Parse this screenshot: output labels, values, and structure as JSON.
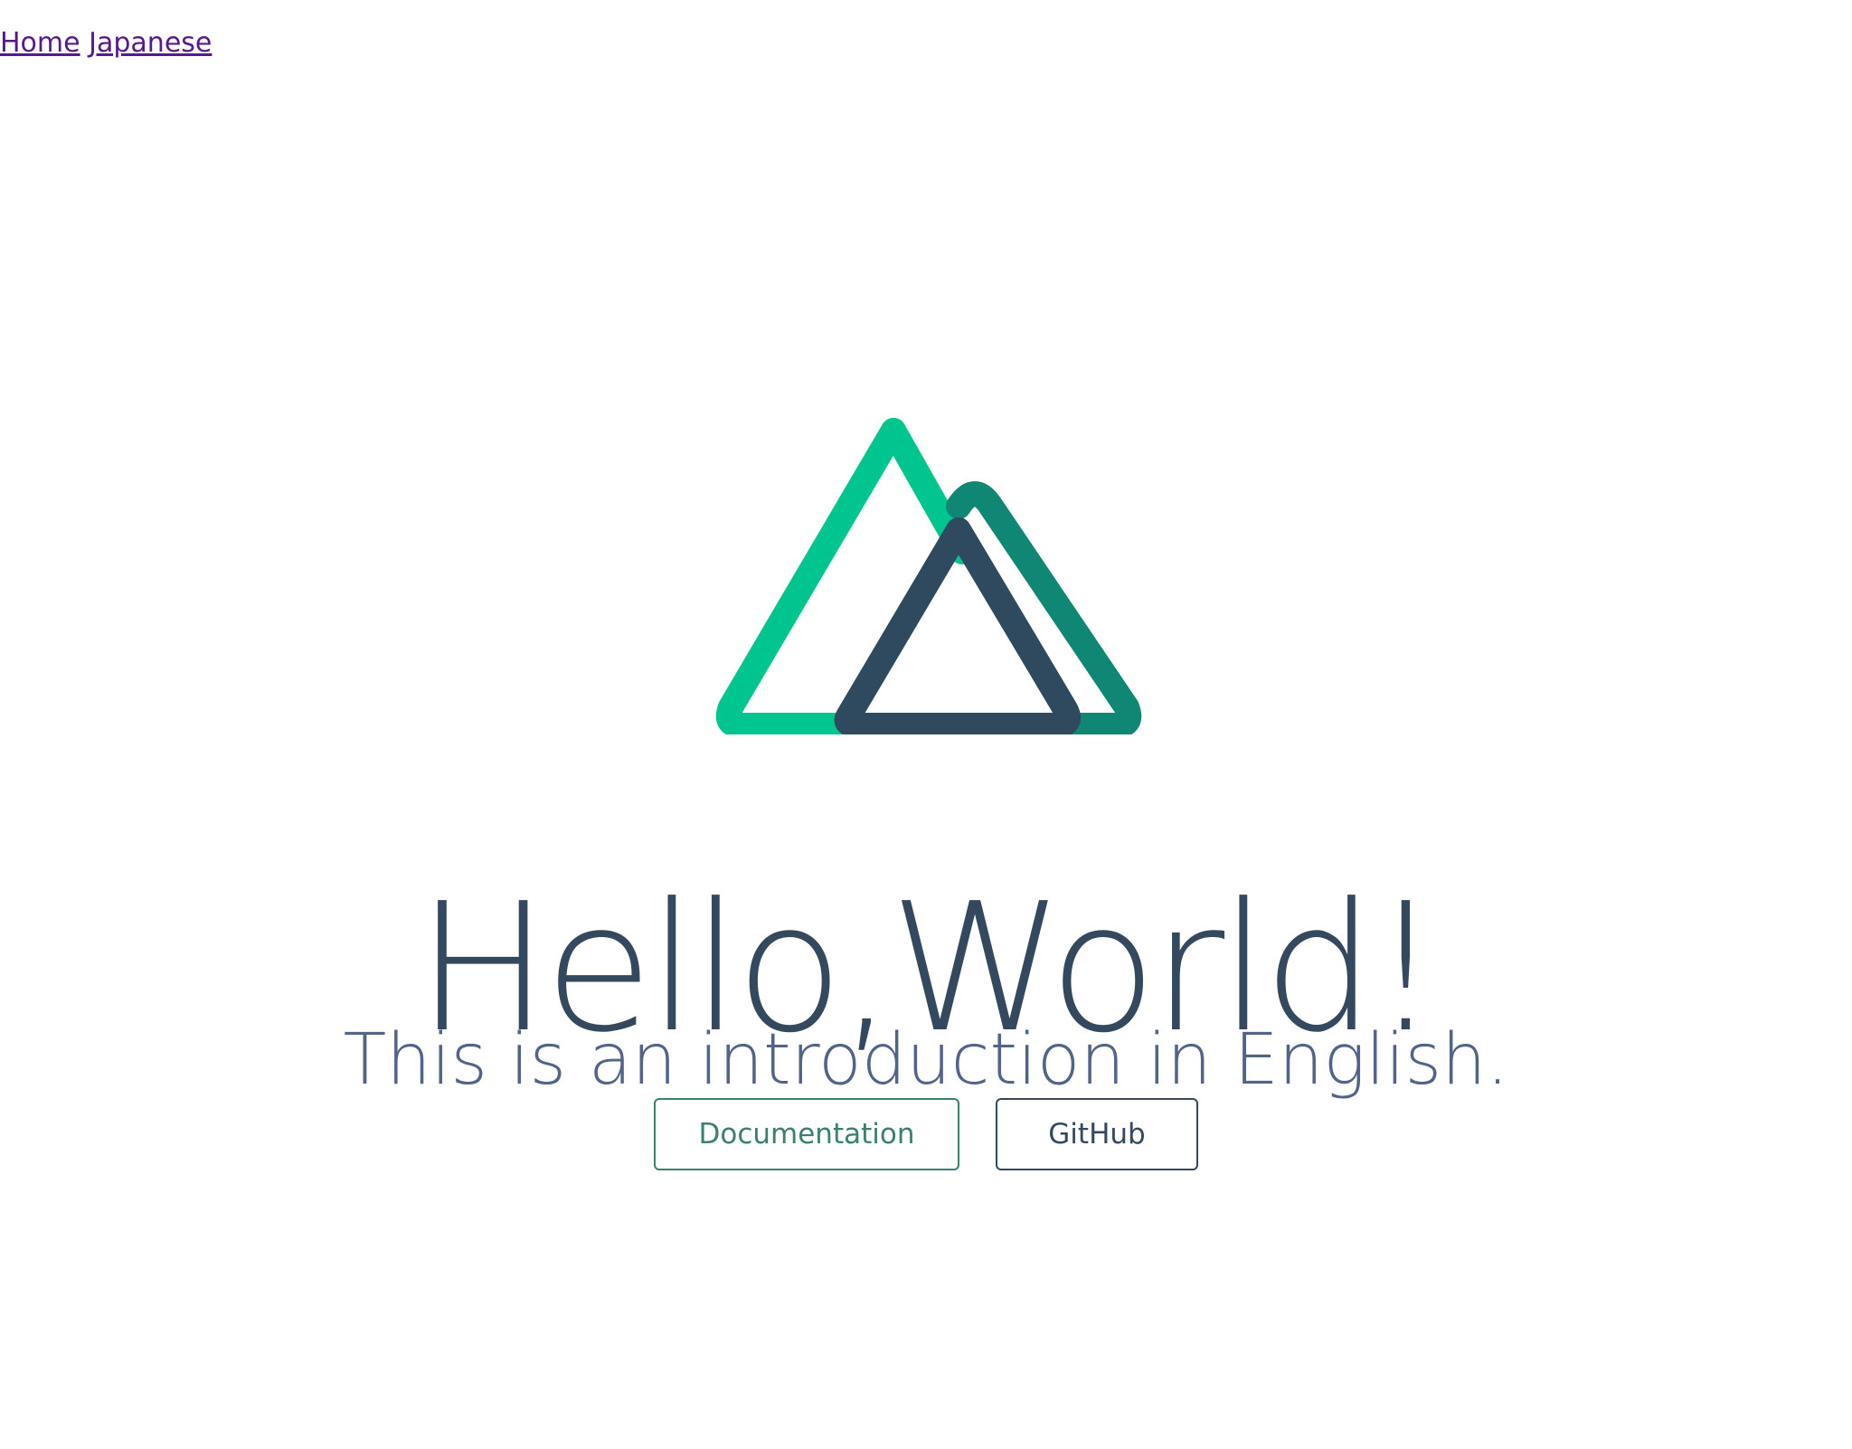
{
  "nav": {
    "links": [
      {
        "label": "Home"
      },
      {
        "label": "Japanese"
      }
    ]
  },
  "hero": {
    "title": "Hello,World!",
    "subtitle": "This is an introduction in English."
  },
  "buttons": {
    "documentation": "Documentation",
    "github": "GitHub"
  },
  "logo": {
    "icon": "nuxt-logo-icon",
    "colors": {
      "left_triangle": "#00C58E",
      "right_triangle": "#108775",
      "front_triangle": "#2F495E"
    }
  },
  "colors": {
    "title": "#35495e",
    "subtitle": "#526488",
    "link": "#551a8b",
    "button_green": "#3b8070",
    "button_grey": "#35495e"
  }
}
